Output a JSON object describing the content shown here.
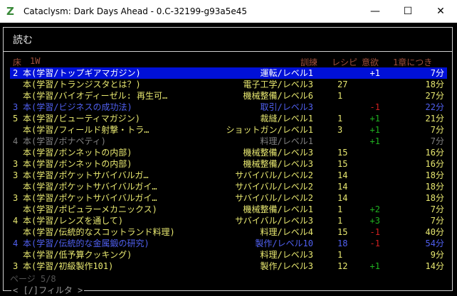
{
  "window": {
    "title": "Cataclysm: Dark Days Ahead - 0.C-32199-g93a5e45",
    "minimize": "—",
    "maximize": "☐",
    "close": "✕"
  },
  "screen": {
    "title": "読む",
    "header": {
      "floor": "床",
      "count": "1W",
      "training": "訓練",
      "recipe": "レシピ",
      "motivation": "意欲",
      "per_chapter": "1章につき"
    },
    "books": [
      {
        "idx": "2",
        "name": "本(学習/トップギアマガジン)",
        "skill": "運転/レベル1",
        "recipes": "",
        "motivation": "+1",
        "time": "7分",
        "color": "#ffffff",
        "mcolor": "#ffffff",
        "selected": true
      },
      {
        "idx": "",
        "name": "本(学習/トランジスタとは？)",
        "skill": "電子工学/レベル3",
        "recipes": "27",
        "motivation": "",
        "time": "18分",
        "color": "#e8e870",
        "mcolor": "#e8e870",
        "selected": false
      },
      {
        "idx": "",
        "name": "本(学習/バイオディーゼル: 再生可…",
        "skill": "機械整備/レベル6",
        "recipes": "1",
        "motivation": "",
        "time": "27分",
        "color": "#e8e870",
        "mcolor": "#e8e870",
        "selected": false
      },
      {
        "idx": "3",
        "name": "本(学習/ビジネスの成功法)",
        "skill": "取引/レベル3",
        "recipes": "",
        "motivation": "-1",
        "time": "22分",
        "color": "#5060f0",
        "mcolor": "#d02020",
        "selected": false
      },
      {
        "idx": "5",
        "name": "本(学習/ビューティマガジン)",
        "skill": "裁縫/レベル1",
        "recipes": "1",
        "motivation": "+1",
        "time": "21分",
        "color": "#e8e870",
        "mcolor": "#20b020",
        "selected": false
      },
      {
        "idx": "",
        "name": "本(学習/フィールド射撃・トラ…",
        "skill": "ショットガン/レベル1",
        "recipes": "3",
        "motivation": "+1",
        "time": "7分",
        "color": "#e8e870",
        "mcolor": "#20b020",
        "selected": false
      },
      {
        "idx": "4",
        "name": "本(学習/ボナペティ)",
        "skill": "料理/レベル1",
        "recipes": "",
        "motivation": "+1",
        "time": "7分",
        "color": "#808080",
        "mcolor": "#20b020",
        "selected": false
      },
      {
        "idx": "",
        "name": "本(学習/ボンネットの内部)",
        "skill": "機械整備/レベル3",
        "recipes": "15",
        "motivation": "",
        "time": "16分",
        "color": "#e8e870",
        "mcolor": "#e8e870",
        "selected": false
      },
      {
        "idx": "3",
        "name": "本(学習/ボンネットの内部)",
        "skill": "機械整備/レベル3",
        "recipes": "15",
        "motivation": "",
        "time": "16分",
        "color": "#e8e870",
        "mcolor": "#e8e870",
        "selected": false
      },
      {
        "idx": "3",
        "name": "本(学習/ポケットサバイバルガ…",
        "skill": "サバイバル/レベル2",
        "recipes": "14",
        "motivation": "",
        "time": "18分",
        "color": "#e8e870",
        "mcolor": "#e8e870",
        "selected": false
      },
      {
        "idx": "",
        "name": "本(学習/ポケットサバイバルガイ…",
        "skill": "サバイバル/レベル2",
        "recipes": "14",
        "motivation": "",
        "time": "18分",
        "color": "#e8e870",
        "mcolor": "#e8e870",
        "selected": false
      },
      {
        "idx": "3",
        "name": "本(学習/ポケットサバイバルガイ…",
        "skill": "サバイバル/レベル2",
        "recipes": "14",
        "motivation": "",
        "time": "18分",
        "color": "#e8e870",
        "mcolor": "#e8e870",
        "selected": false
      },
      {
        "idx": "",
        "name": "本(学習/ポピュラーメカニックス)",
        "skill": "機械整備/レベル1",
        "recipes": "1",
        "motivation": "+2",
        "time": "7分",
        "color": "#e8e870",
        "mcolor": "#20b020",
        "selected": false
      },
      {
        "idx": "4",
        "name": "本(学習/レンズを通して)",
        "skill": "サバイバル/レベル3",
        "recipes": "1",
        "motivation": "+3",
        "time": "7分",
        "color": "#e8e870",
        "mcolor": "#20b020",
        "selected": false
      },
      {
        "idx": "",
        "name": "本(学習/伝統的なスコットランド料理)",
        "skill": "料理/レベル4",
        "recipes": "15",
        "motivation": "-1",
        "time": "40分",
        "color": "#e8e870",
        "mcolor": "#d02020",
        "selected": false
      },
      {
        "idx": "4",
        "name": "本(学習/伝統的な金属鍛の研究)",
        "skill": "製作/レベル10",
        "recipes": "18",
        "motivation": "-1",
        "time": "54分",
        "color": "#5060f0",
        "mcolor": "#d02020",
        "selected": false
      },
      {
        "idx": "",
        "name": "本(学習/低予算クッキング)",
        "skill": "料理/レベル3",
        "recipes": "1",
        "motivation": "",
        "time": "9分",
        "color": "#e8e870",
        "mcolor": "#e8e870",
        "selected": false
      },
      {
        "idx": "3",
        "name": "本(学習/初級製作101)",
        "skill": "製作/レベル3",
        "recipes": "12",
        "motivation": "+1",
        "time": "14分",
        "color": "#e8e870",
        "mcolor": "#20b020",
        "selected": false
      }
    ],
    "footer": {
      "page": "ページ 5/8",
      "filter": "< [/]フィルタ >"
    }
  }
}
